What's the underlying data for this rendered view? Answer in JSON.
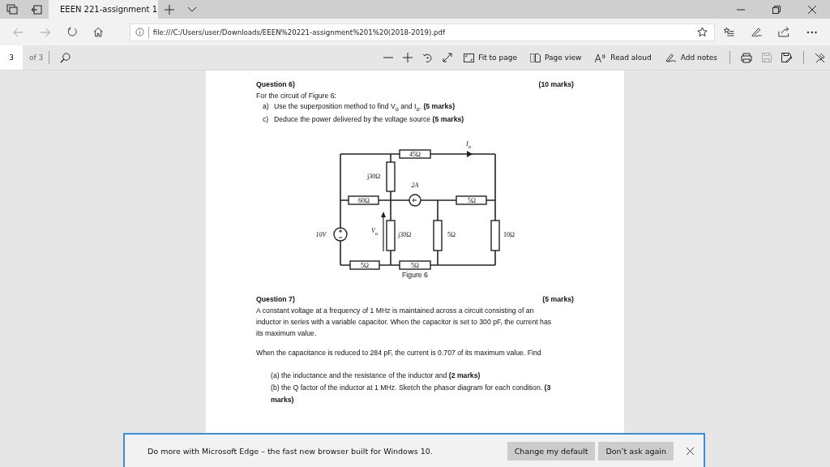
{
  "tab_bar": {
    "tabs": [
      {
        "title": "EEEN 221-assignment 1",
        "selected": true
      }
    ]
  },
  "address_bar": {
    "url": "file:///C:/Users/user/Downloads/EEEN%20221-assignment%201%20(2018-2019).pdf"
  },
  "pdf_toolbar": {
    "page_number": "3",
    "page_count": "of 3",
    "buttons": [
      {
        "kind": "fit",
        "label": "Fit to page"
      },
      {
        "kind": "view",
        "label": "Page view"
      },
      {
        "kind": "read",
        "label": "Read aloud"
      },
      {
        "kind": "notes",
        "label": "Add notes"
      }
    ]
  },
  "document": {
    "question_6": {
      "heading": "Question 6)",
      "marks": "(10 marks)",
      "intro": "For the circuit of Figure 6:",
      "parts": [
        {
          "label": "a)",
          "text": "Use the superposition method to find V$_{o}$ and I$_{o}$. **(5 marks)**"
        },
        {
          "label": "c)",
          "text": "Deduce the power delivered by the voltage source **(5 marks)**"
        }
      ],
      "figure": {
        "labels": [
          "I$_{o}$",
          "45Ω",
          "j30Ω",
          "2A",
          "60Ω",
          "5Ω",
          "10V",
          "V$_{o}$",
          "j30Ω",
          "5Ω",
          "10Ω",
          "5Ω",
          "5Ω"
        ],
        "caption": "Figure 6"
      }
    },
    "question_7": {
      "heading": "Question 7)",
      "marks": "(5 marks)",
      "paragraphs": [
        "A constant voltage at a frequency of 1 MHz is maintained across a circuit consisting of an inductor in series with a variable capacitor. When the capacitor is set to 300 pF, the current has its maximum value.",
        "When the capacitance is reduced to 284 pF, the current is 0.707 of its maximum value. Find"
      ],
      "parts": [
        "(a) the inductance and the resistance of the inductor and **(2 marks)**",
        "(b) the Q factor of the inductor at 1 MHz. Sketch the phasor diagram for each condition. **(3 marks)**"
      ]
    }
  },
  "notification": {
    "message": "Do more with Microsoft Edge – the fast new browser built for Windows 10.",
    "buttons": [
      "Change my default",
      "Don’t ask again"
    ]
  }
}
